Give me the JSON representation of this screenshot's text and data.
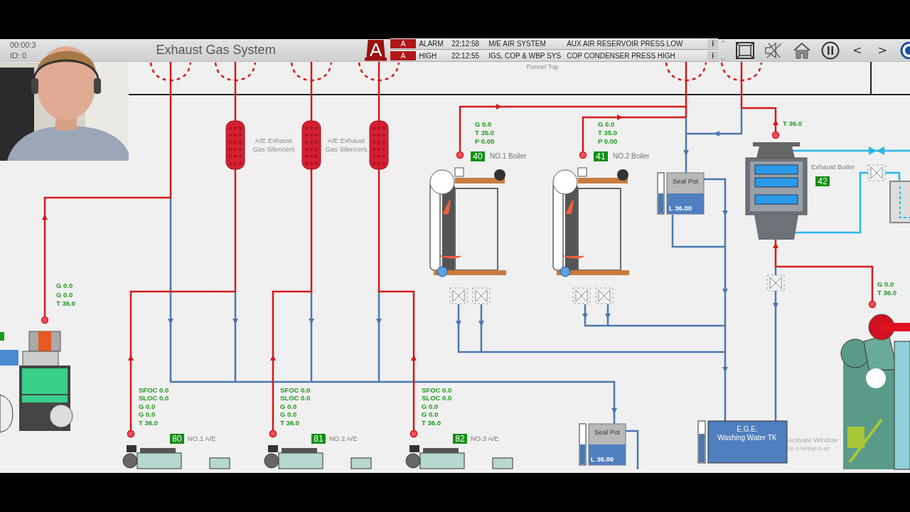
{
  "header": {
    "clock": "00:00:3",
    "id": "ID: 0",
    "title": "Exhaust Gas System",
    "alarm_icon": "A",
    "alarms": [
      {
        "badge": "A",
        "level": "ALARM",
        "time": "22:12:58",
        "system": "M/E AIR SYSTEM",
        "message": "AUX AIR RESERVOIR PRESS LOW",
        "info": "i"
      },
      {
        "badge": "A",
        "level": "HIGH",
        "time": "22:12:55",
        "system": "IGS, COP & WBP SYS",
        "message": "COP CONDENSER PRESS HIGH",
        "info": "i"
      }
    ],
    "nav": [
      "<",
      ">"
    ]
  },
  "diagram": {
    "funnel_label": "Funnel Top",
    "silencer_labels": [
      [
        "A/E Exhaust",
        "Gas Silencers"
      ],
      [
        "A/E Exhaust",
        "Gas Silencers"
      ]
    ],
    "boilers": [
      {
        "tag": "40",
        "name": "NO.1 Boiler",
        "readings": [
          "G 0.0",
          "T 35.0",
          "P 0.00"
        ]
      },
      {
        "tag": "41",
        "name": "NO.2 Boiler",
        "readings": [
          "G 0.0",
          "T 35.0",
          "P 0.00"
        ]
      }
    ],
    "exhaust_boiler": {
      "tag": "42",
      "name": "Exhaust Boiler",
      "readings": [
        "T 36.0"
      ]
    },
    "seal_pots": [
      {
        "label": "Seal Pot",
        "reading": "L 36.00",
        "level": 0.5
      },
      {
        "label": "Seal Pot",
        "reading": "L 36.00",
        "level": 0.5
      }
    ],
    "washing_tank": {
      "label_lines": [
        "E.G.E.",
        "Washing Water TK"
      ],
      "level": 0.7
    },
    "incinerator": {
      "readings": [
        "G 0.0",
        "G 0.0",
        "T 36.0"
      ]
    },
    "generators": [
      {
        "tag": "80",
        "name": "NO.1 A/E",
        "readings": [
          "SFOC 0.0",
          "SLOC 0.0",
          "G 0.0",
          "G 0.0",
          "T 36.0"
        ]
      },
      {
        "tag": "81",
        "name": "NO.2 A/E",
        "readings": [
          "SFOC 0.0",
          "SLOC 0.0",
          "G 0.0",
          "G 0.0",
          "T 36.0"
        ]
      },
      {
        "tag": "82",
        "name": "NO.3 A/E",
        "readings": [
          "SFOC 0.0",
          "SLOC 0.0",
          "G 0.0",
          "G 0.0",
          "T 36.0"
        ]
      }
    ],
    "main_engine": {
      "readings": [
        "G 0.0",
        "T 36.0"
      ]
    },
    "activation_notice": [
      "Activate Window",
      "Go to Settings to act"
    ]
  }
}
